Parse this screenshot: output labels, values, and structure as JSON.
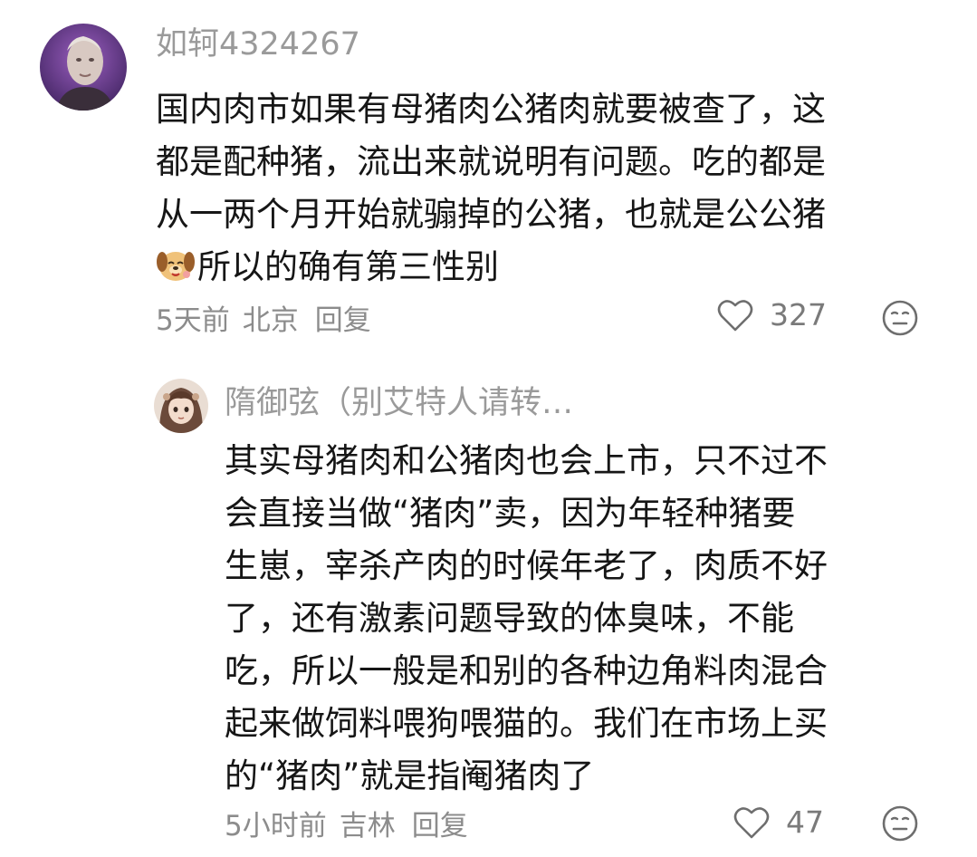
{
  "comments": [
    {
      "username": "如轲4324267",
      "avatar": "portrait-avatar",
      "lines": [
        "国内肉市如果有母猪肉公猪肉就要被查了，这",
        "都是配种猪，流出来就说明有问题。吃的都是",
        "从一两个月开始就骟掉的公猪，也就是公公猪"
      ],
      "last_line_emoji": "puppy-emoji",
      "last_line": "所以的确有第三性别",
      "time": "5天前",
      "location": "北京",
      "reply_label": "回复",
      "likes": "327"
    }
  ],
  "replies": [
    {
      "username": "隋御弦（别艾特人请转…",
      "avatar": "anime-girl-avatar",
      "lines": [
        "其实母猪肉和公猪肉也会上市，只不过不",
        "会直接当做“猪肉”卖，因为年轻种猪要",
        "生崽，宰杀产肉的时候年老了，肉质不好",
        "了，还有激素问题导致的体臭味，不能",
        "吃，所以一般是和别的各种边角料肉混合",
        "起来做饲料喂狗喂猫的。我们在市场上买",
        "的“猪肉”就是指阉猪肉了"
      ],
      "time": "5小时前",
      "location": "吉林",
      "reply_label": "回复",
      "likes": "47"
    }
  ]
}
